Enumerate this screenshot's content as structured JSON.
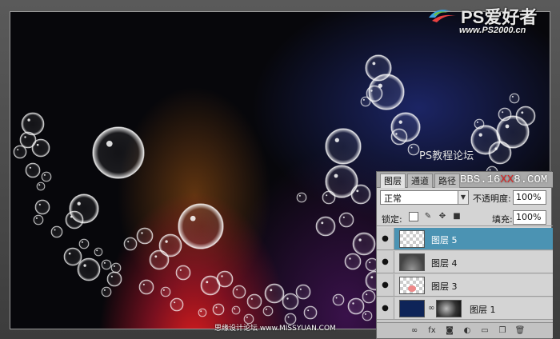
{
  "logo": {
    "text": "PS爱好者",
    "url": "www.PS2000.cn"
  },
  "watermark_top": "PS教程论坛",
  "watermark_bottom": "思缘设计论坛 www.MISSYUAN.COM",
  "layers_panel": {
    "tabs": [
      "图层",
      "通道",
      "路径"
    ],
    "active_tab": "图层",
    "bbs_watermark": {
      "pre": "BBS.16",
      "red": "XX",
      "post": "8.COM"
    },
    "blend_mode": "正常",
    "opacity_label": "不透明度:",
    "opacity_value": "100%",
    "lock_label": "锁定:",
    "fill_label": "填充:",
    "fill_value": "100%",
    "layers": [
      {
        "name": "图层 5",
        "selected": true,
        "visible": true
      },
      {
        "name": "图层 4",
        "selected": false,
        "visible": true
      },
      {
        "name": "图层 3",
        "selected": false,
        "visible": true
      },
      {
        "name": "图层 1",
        "selected": false,
        "visible": true
      }
    ]
  },
  "colors": {
    "selected_layer": "#4b93b3",
    "background_red": "#e61e1e",
    "background_blue": "#1e2870"
  }
}
